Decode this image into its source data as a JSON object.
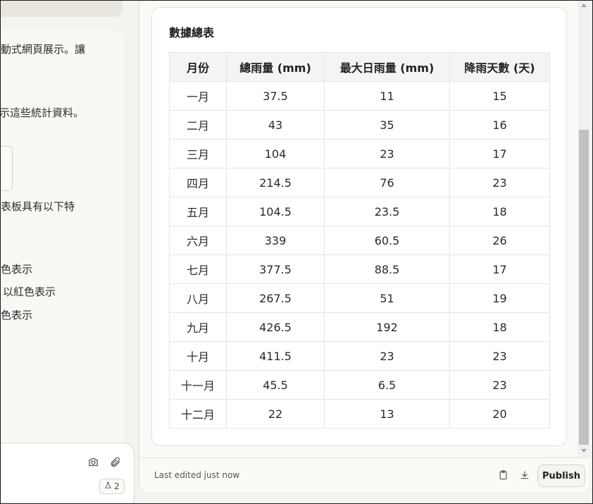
{
  "chat": {
    "lines": [
      "動式網頁展示。讓",
      "示這些統計資料。",
      "表板具有以下特",
      "色表示",
      "以紅色表示",
      "色表示"
    ],
    "badge_count": "2"
  },
  "artifact": {
    "card_title": "數據總表",
    "table": {
      "headers": [
        "月份",
        "總雨量 (mm)",
        "最大日雨量 (mm)",
        "降雨天數 (天)"
      ],
      "rows": [
        [
          "一月",
          "37.5",
          "11",
          "15"
        ],
        [
          "二月",
          "43",
          "35",
          "16"
        ],
        [
          "三月",
          "104",
          "23",
          "17"
        ],
        [
          "四月",
          "214.5",
          "76",
          "23"
        ],
        [
          "五月",
          "104.5",
          "23.5",
          "18"
        ],
        [
          "六月",
          "339",
          "60.5",
          "26"
        ],
        [
          "七月",
          "377.5",
          "88.5",
          "17"
        ],
        [
          "八月",
          "267.5",
          "51",
          "19"
        ],
        [
          "九月",
          "426.5",
          "192",
          "18"
        ],
        [
          "十月",
          "411.5",
          "23",
          "23"
        ],
        [
          "十一月",
          "45.5",
          "6.5",
          "23"
        ],
        [
          "十二月",
          "22",
          "13",
          "20"
        ]
      ]
    },
    "footer": {
      "last_edited": "Last edited just now",
      "publish_label": "Publish"
    }
  },
  "icons": {
    "camera": "camera-icon",
    "attach": "paperclip-icon",
    "flask": "flask-icon",
    "copy": "clipboard-icon",
    "download": "download-icon"
  }
}
